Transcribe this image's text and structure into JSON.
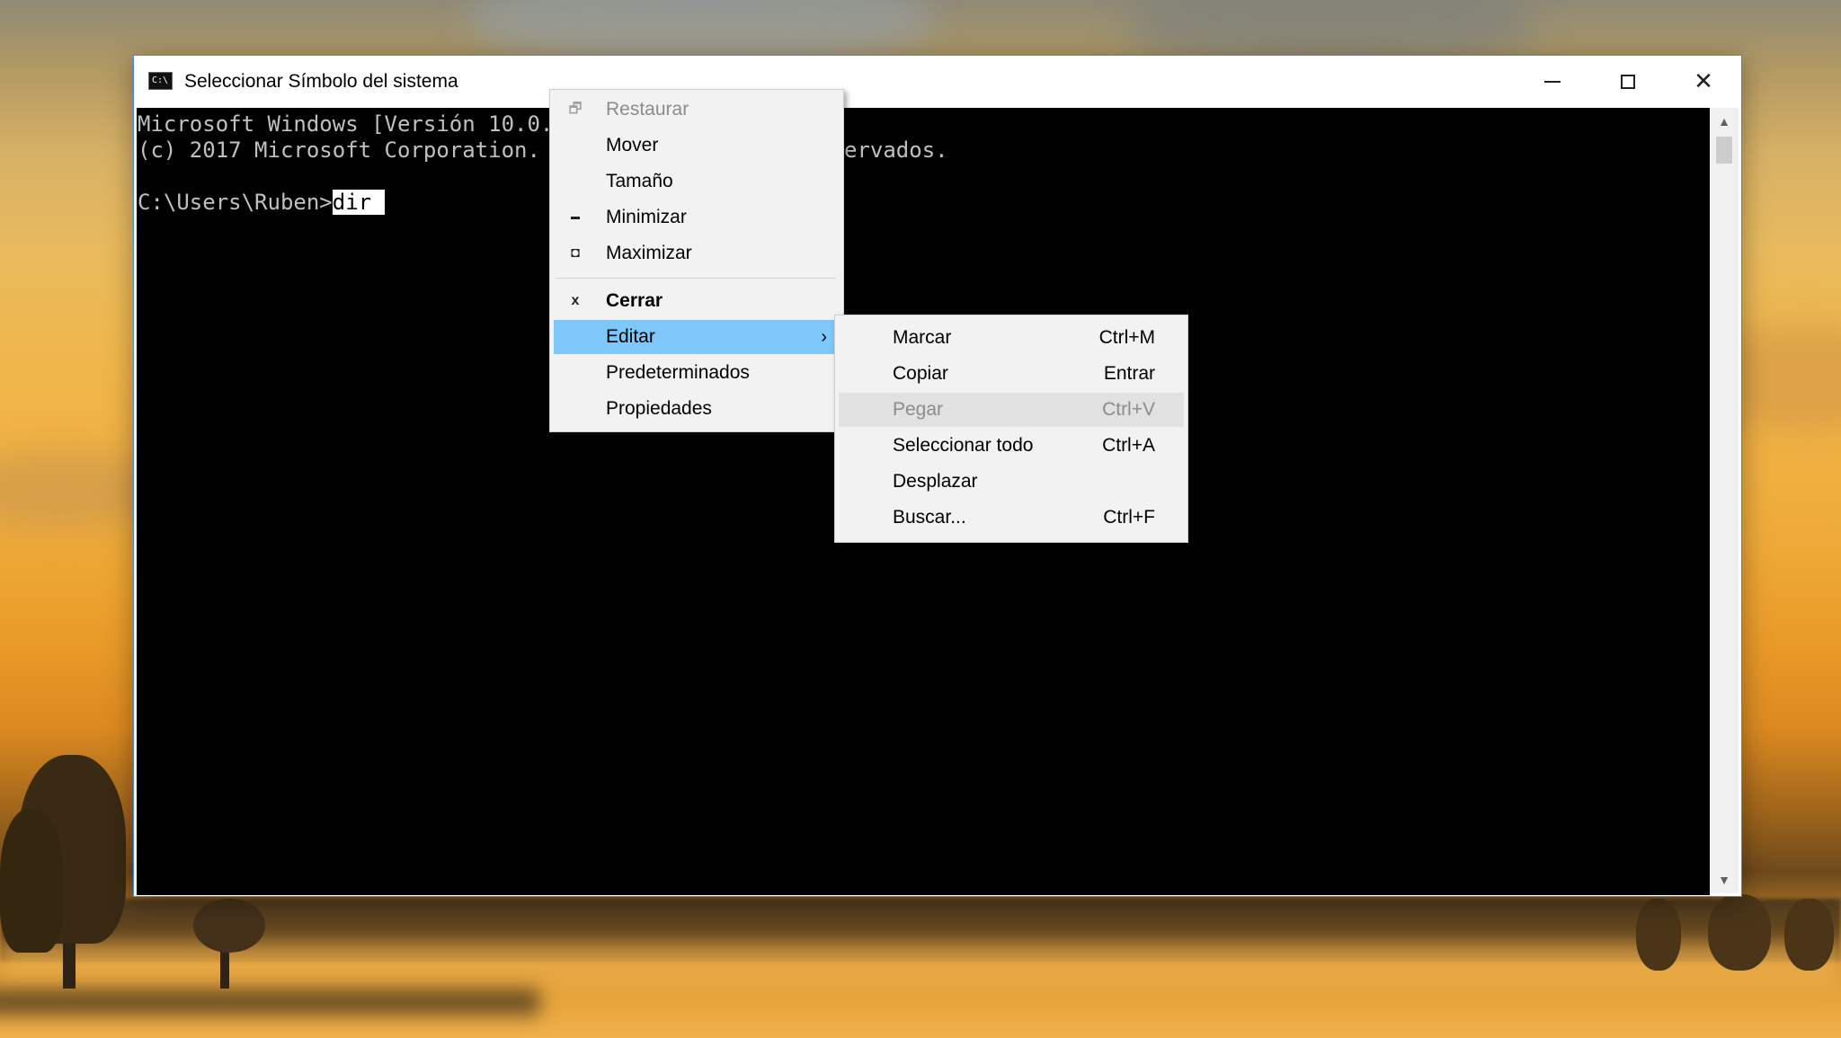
{
  "window": {
    "title": "Seleccionar Símbolo del sistema",
    "icon_text": "C:\\",
    "controls": {
      "minimize": "minimize-icon",
      "maximize": "maximize-icon",
      "close": "close-icon",
      "close_glyph": "✕"
    }
  },
  "console": {
    "line1_left": "Microsoft Windows [Versión 10.0.",
    "line1_right": "",
    "line2_left": "(c) 2017 Microsoft Corporation.",
    "line2_right": "ervados.",
    "prompt": "C:\\Users\\Ruben>",
    "selected_text": "dir "
  },
  "scrollbar": {
    "up_glyph": "▲",
    "down_glyph": "▼"
  },
  "system_menu": {
    "items": [
      {
        "label": "Restaurar",
        "icon": "🗗",
        "icon_name": "restore-icon",
        "state": "disabled"
      },
      {
        "label": "Mover",
        "icon": "",
        "state": "normal"
      },
      {
        "label": "Tamaño",
        "icon": "",
        "state": "normal"
      },
      {
        "label": "Minimizar",
        "icon": "▬",
        "icon_name": "minimize-icon",
        "state": "normal"
      },
      {
        "label": "Maximizar",
        "icon": "◘",
        "icon_name": "maximize-icon",
        "state": "normal"
      },
      {
        "label": "Cerrar",
        "icon": "x",
        "icon_name": "close-icon",
        "state": "bold"
      },
      {
        "label": "Editar",
        "icon": "",
        "state": "highlighted",
        "submenu_arrow": "›"
      },
      {
        "label": "Predeterminados",
        "icon": "",
        "state": "normal"
      },
      {
        "label": "Propiedades",
        "icon": "",
        "state": "normal"
      }
    ]
  },
  "edit_menu": {
    "items": [
      {
        "label": "Marcar",
        "shortcut": "Ctrl+M",
        "state": "normal"
      },
      {
        "label": "Copiar",
        "shortcut": "Entrar",
        "state": "normal"
      },
      {
        "label": "Pegar",
        "shortcut": "Ctrl+V",
        "state": "disabled-hovered"
      },
      {
        "label": "Seleccionar todo",
        "shortcut": "Ctrl+A",
        "state": "normal"
      },
      {
        "label": "Desplazar",
        "shortcut": "",
        "state": "normal"
      },
      {
        "label": "Buscar...",
        "shortcut": "Ctrl+F",
        "state": "normal"
      }
    ]
  },
  "colors": {
    "menu_highlight": "#7dc7fb",
    "menu_background": "#f2f2f2",
    "window_border": "#3f8fd8",
    "console_background": "#000000",
    "console_text": "#c0c0c0"
  }
}
